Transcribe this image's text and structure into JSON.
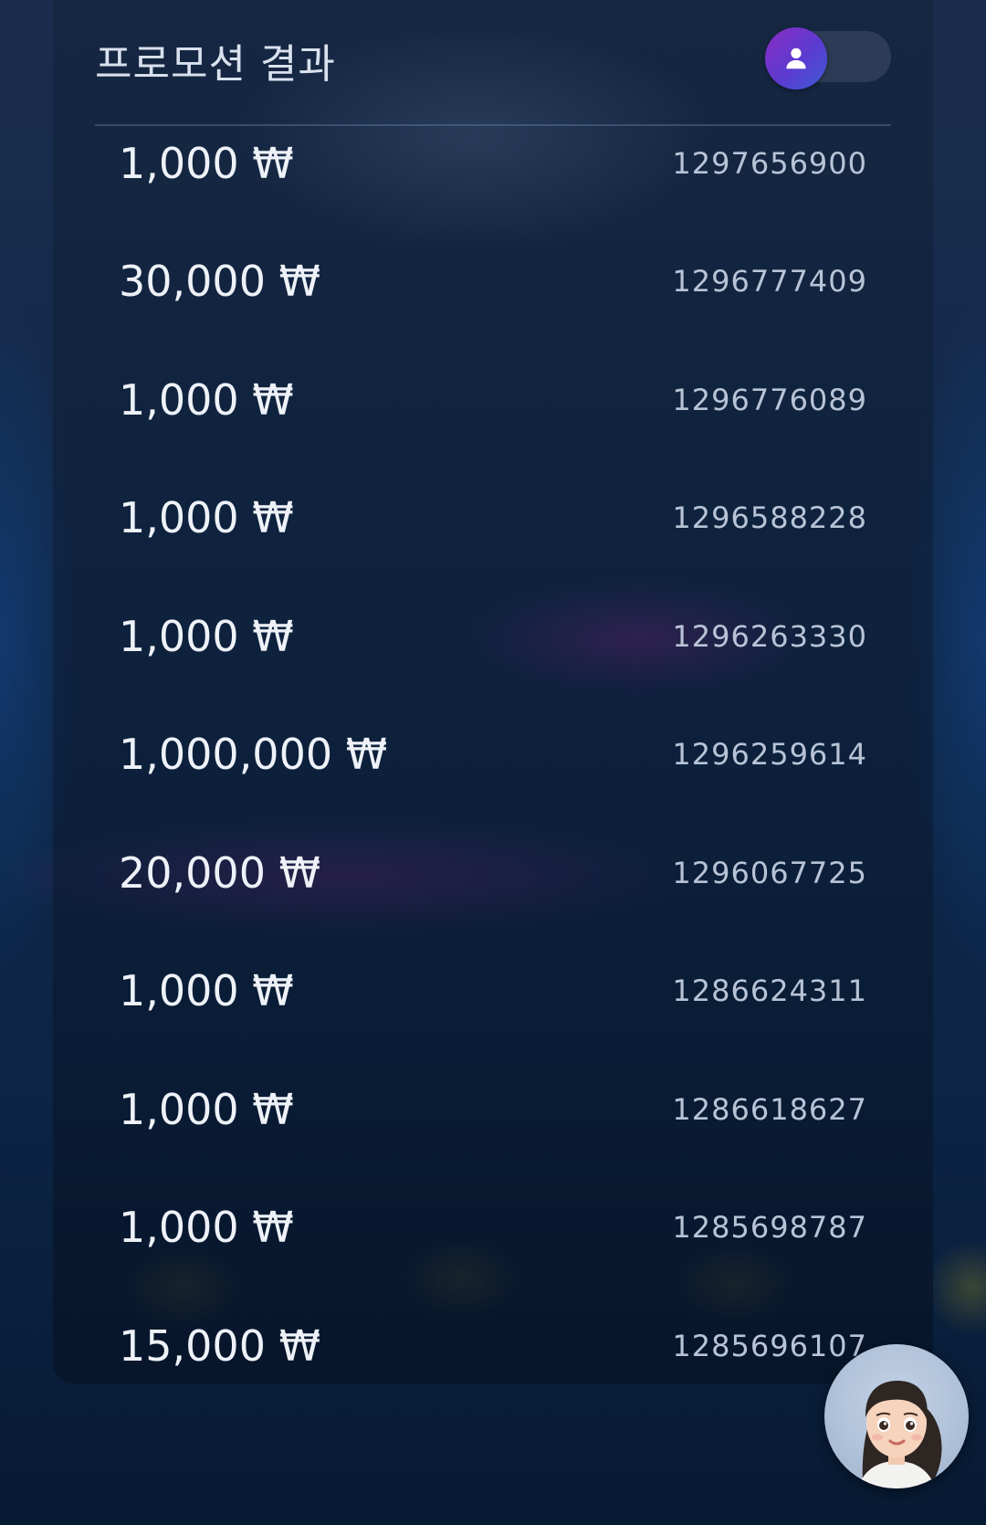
{
  "header": {
    "title": "프로모션 결과",
    "toggle_icon": "user-icon"
  },
  "results": [
    {
      "amount": "1,000 ₩",
      "id": "1297656900"
    },
    {
      "amount": "30,000 ₩",
      "id": "1296777409"
    },
    {
      "amount": "1,000 ₩",
      "id": "1296776089"
    },
    {
      "amount": "1,000 ₩",
      "id": "1296588228"
    },
    {
      "amount": "1,000 ₩",
      "id": "1296263330"
    },
    {
      "amount": "1,000,000 ₩",
      "id": "1296259614"
    },
    {
      "amount": "20,000 ₩",
      "id": "1296067725"
    },
    {
      "amount": "1,000 ₩",
      "id": "1286624311"
    },
    {
      "amount": "1,000 ₩",
      "id": "1286618627"
    },
    {
      "amount": "1,000 ₩",
      "id": "1285698787"
    },
    {
      "amount": "15,000 ₩",
      "id": "1285696107"
    }
  ],
  "assistant": {
    "icon": "assistant-avatar"
  },
  "colors": {
    "toggle_gradient_start": "#8a2cc2",
    "toggle_gradient_end": "#3d5bd8",
    "amount_text": "#eef2f8",
    "id_text": "#b8c4d6"
  }
}
